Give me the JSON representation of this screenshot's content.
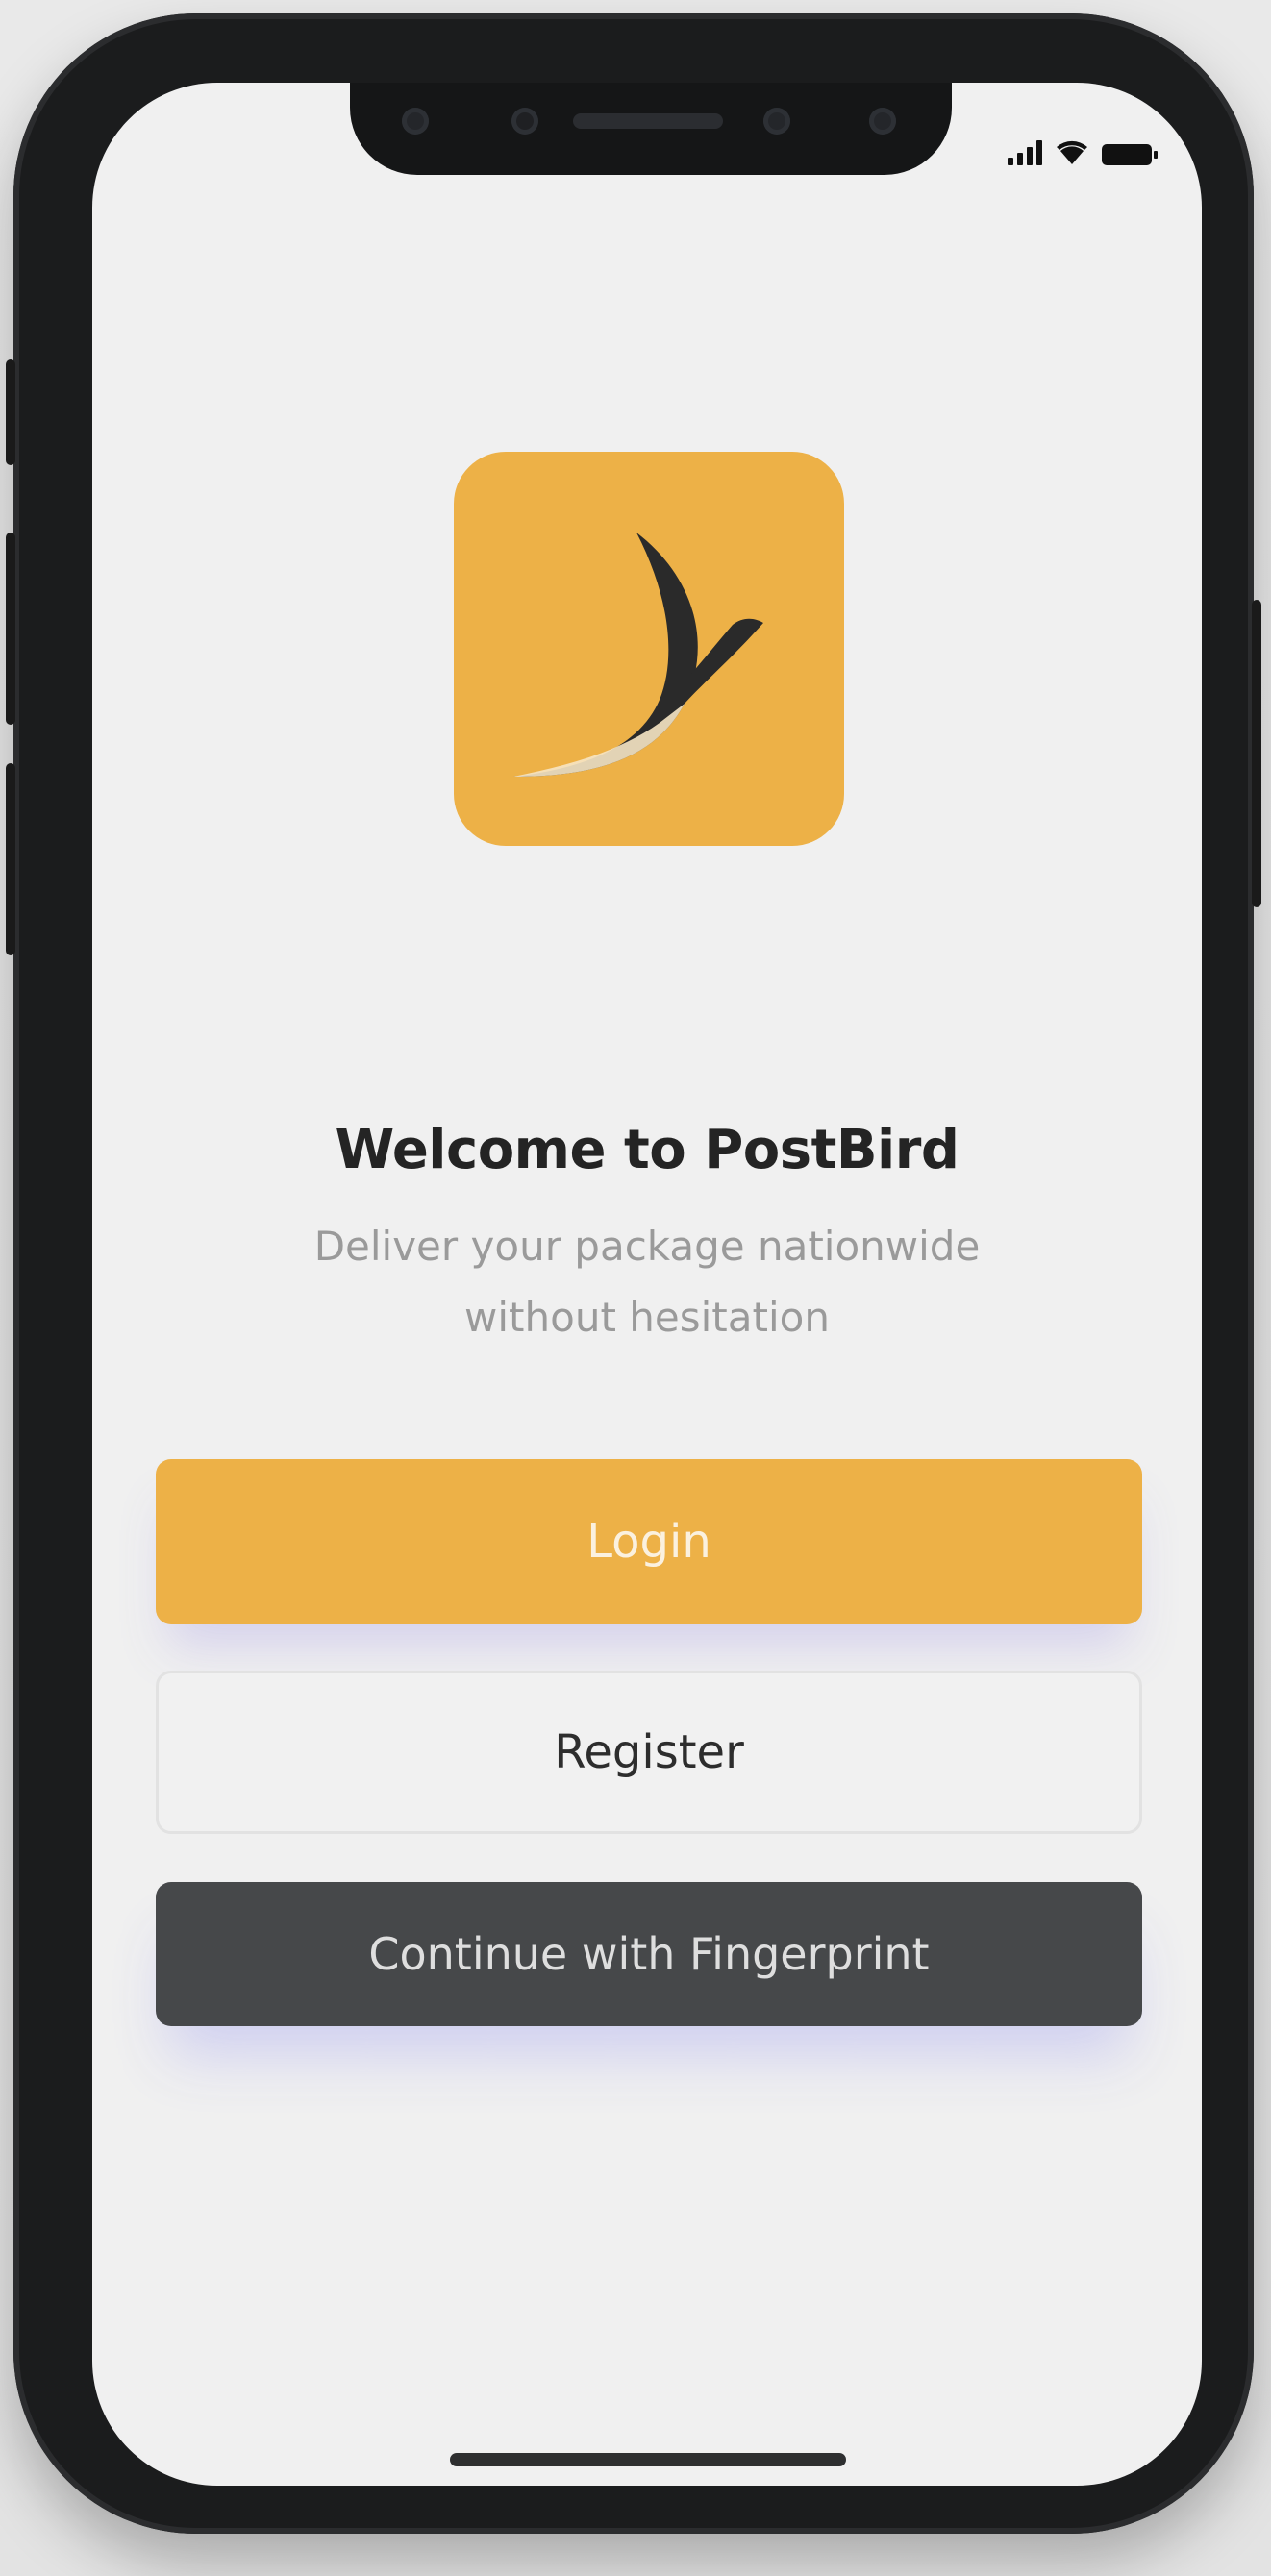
{
  "status_bar": {
    "signal_icon": "cellular-signal-icon",
    "wifi_icon": "wifi-icon",
    "battery_icon": "battery-icon"
  },
  "app": {
    "logo_icon": "postbird-swallow-logo",
    "brand_color": "#edb147"
  },
  "welcome": {
    "title": "Welcome to PostBird",
    "subtitle_line1": "Deliver your package nationwide",
    "subtitle_line2": "without hesitation"
  },
  "actions": {
    "login_label": "Login",
    "register_label": "Register",
    "fingerprint_label": "Continue with Fingerprint"
  },
  "colors": {
    "accent": "#edb147",
    "dark_button": "#46484a",
    "background": "#f0f0f0",
    "title_text": "#242424",
    "subtitle_text": "#9a9a9a"
  }
}
